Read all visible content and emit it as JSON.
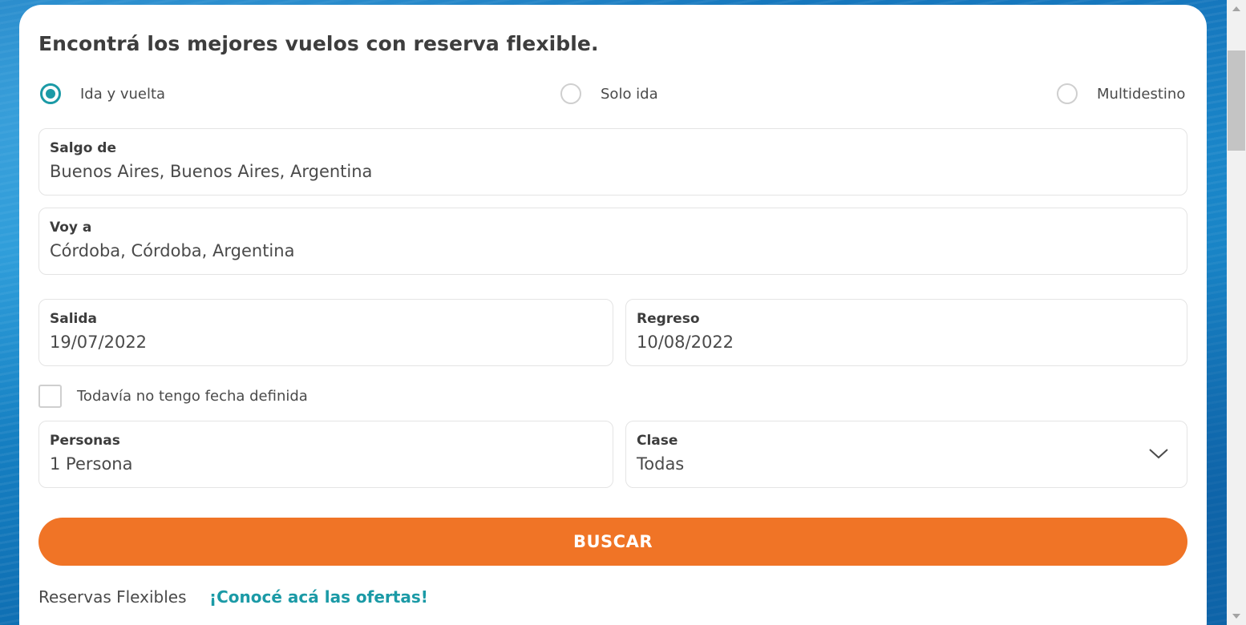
{
  "colors": {
    "accent_teal": "#1b9aa6",
    "button_orange": "#f07426",
    "text_dark": "#3d3d3d",
    "text_body": "#4a4a4a",
    "border": "#e4e4e4"
  },
  "form": {
    "title": "Encontrá los mejores vuelos con reserva flexible.",
    "trip_types": [
      {
        "label": "Ida y vuelta",
        "selected": true
      },
      {
        "label": "Solo ida",
        "selected": false
      },
      {
        "label": "Multidestino",
        "selected": false
      }
    ],
    "origin": {
      "label": "Salgo de",
      "value": "Buenos Aires, Buenos Aires, Argentina"
    },
    "destination": {
      "label": "Voy a",
      "value": "Córdoba, Córdoba, Argentina"
    },
    "departure": {
      "label": "Salida",
      "value": "19/07/2022"
    },
    "return": {
      "label": "Regreso",
      "value": "10/08/2022"
    },
    "no_date": {
      "label": "Todavía no tengo fecha definida",
      "checked": false
    },
    "passengers": {
      "label": "Personas",
      "value": "1 Persona"
    },
    "cabin_class": {
      "label": "Clase",
      "value": "Todas",
      "icon": "chevron-down-icon"
    },
    "search_button": "BUSCAR"
  },
  "footer": {
    "text": "Reservas Flexibles",
    "link": "¡Conocé acá las ofertas!"
  },
  "scrollbar": {
    "up_icon": "scroll-up-arrow-icon",
    "down_icon": "scroll-down-arrow-icon"
  }
}
